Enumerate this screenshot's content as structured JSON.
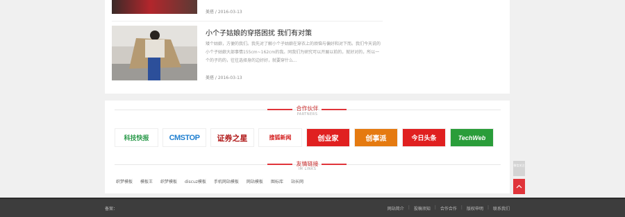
{
  "article_top": {
    "meta": "美搭 / 2016-03-13"
  },
  "article": {
    "title": "小个子姑娘的穿搭困扰 我们有对策",
    "summary": "矮个姑娘，方便的我们。我先对了解小个子姑娘在穿衣上的烦恼与偏好和对下而。我们今天说的小个子姑娘大部事情155cm~162cm的我。同我们为研究可以开展以前的，就好对的，所以一个的子的的，往往选择身的边好好，就要穿什么...",
    "meta": "美搭 / 2016-03-13"
  },
  "partners": {
    "title": "合作伙伴",
    "subtitle": "PARTNERS",
    "logos": [
      {
        "name": "科技快报",
        "color": "#2a9a4a"
      },
      {
        "name": "CMSTOP",
        "color": "#1f7fd0"
      },
      {
        "name": "证券之星",
        "color": "#b01818"
      },
      {
        "name": "搜狐新闻",
        "color": "#d42020"
      },
      {
        "name": "创业家",
        "color": "#ffffff",
        "bg": "#e02020"
      },
      {
        "name": "创事派",
        "color": "#ffffff",
        "bg": "#e57a10"
      },
      {
        "name": "今日头条",
        "color": "#ffffff",
        "bg": "#e02020"
      },
      {
        "name": "TechWeb",
        "color": "#ffffff",
        "bg": "#2a9d3a"
      }
    ]
  },
  "friend_links": {
    "title": "友情链接",
    "subtitle": "IM LINKS",
    "items": [
      "织梦模板",
      "模板王",
      "织梦模板",
      "discuz模板",
      "手机网站模板",
      "网站模板",
      "图标库",
      "站长网"
    ]
  },
  "footer": {
    "record_label": "备案：",
    "links": [
      "网站简介",
      "投稿须知",
      "合作合作",
      "版权申明",
      "联系我们"
    ]
  },
  "side": {
    "ad_text": "微信关注"
  },
  "colors": {
    "accent": "#e0343a",
    "footer_bg": "#3d3d3d"
  }
}
